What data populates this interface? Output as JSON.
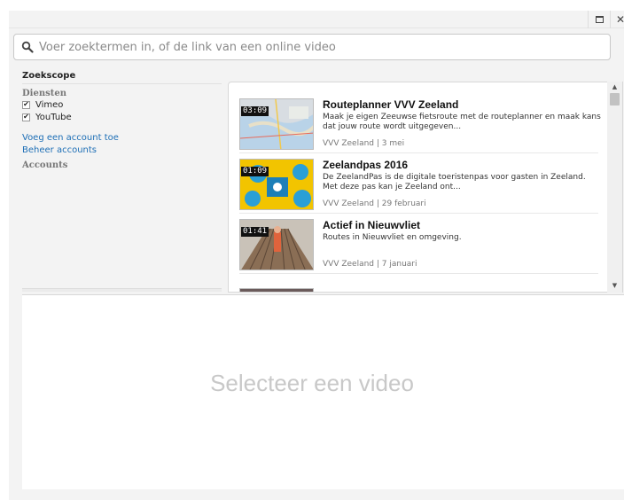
{
  "window": {
    "maximize_icon": "maximize-icon",
    "close_glyph": "✕"
  },
  "search": {
    "placeholder": "Voer zoektermen in, of de link van een online video",
    "value": ""
  },
  "sidebar": {
    "scope_title": "Zoekscope",
    "services_label": "Diensten",
    "services": [
      {
        "label": "Vimeo",
        "checked": true
      },
      {
        "label": "YouTube",
        "checked": true
      }
    ],
    "add_account": "Voeg een account toe",
    "manage_accounts": "Beheer accounts",
    "accounts_label": "Accounts"
  },
  "results": [
    {
      "duration": "03:09",
      "title": "Routeplanner VVV Zeeland",
      "description": "Maak je eigen Zeeuwse fietsroute met de routeplanner en maak kans dat jouw route wordt uitgegeven...",
      "meta": "VVV Zeeland | 3 mei"
    },
    {
      "duration": "01:09",
      "title": "Zeelandpas 2016",
      "description": "De ZeelandPas is de digitale toeristenpas voor gasten in Zeeland. Met deze pas kan je Zeeland ont...",
      "meta": "VVV Zeeland | 29 februari"
    },
    {
      "duration": "01:41",
      "title": "Actief in Nieuwvliet",
      "description": "Routes in Nieuwvliet en omgeving.",
      "meta": "VVV Zeeland | 7 januari"
    }
  ],
  "preview": {
    "empty_text": "Selecteer een video"
  },
  "colors": {
    "link": "#1e6fb6",
    "placeholder": "#c8c8c8"
  }
}
